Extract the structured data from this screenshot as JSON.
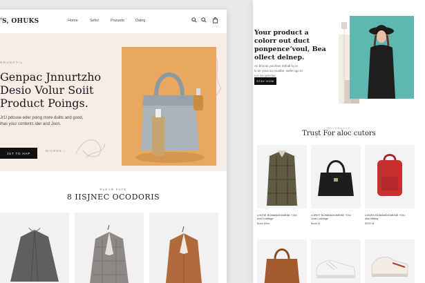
{
  "left": {
    "logo": "'S, OHUKS",
    "nav": [
      "Home",
      "Sefor",
      "Pozuots",
      "Dalng"
    ],
    "hero": {
      "eyebrow": "NRUEFTIL",
      "headline_lines": [
        "Genpac Jnnurtzho",
        "Desio Volur Soiit",
        "Product Poings."
      ],
      "subtext_lines": [
        "Jr1I pdcuse eder poing more dulits and good,",
        "ihas your contents ider and Joon."
      ],
      "primary_button": "JUT TO HAP",
      "secondary_link": "NICHOS ›"
    },
    "section": {
      "eyebrow": "PLEAR FATE",
      "title": "8 IISJNEC OCODORIS"
    }
  },
  "right": {
    "headline_lines": [
      "Your product a",
      "colorr out duct",
      "ponpenceʼvoul, Bea",
      "ollect delnep."
    ],
    "subtext_lines": [
      "An bhoots you feos trefudl lo ce",
      "lu ter yous sa rouatbe, welle ngo to",
      "cur ocu pricous."
    ],
    "button": "STAY HOW",
    "section": {
      "eyebrow": "SUYERAUGE",
      "title": "Trust For aloc cutors",
      "products": [
        {
          "name": "LHOSE BOMANDIGMENE YOU",
          "sub": "Ans Lnddoge",
          "price": "$ose Mesl"
        },
        {
          "name": "LOROT BOMANDIGMENE YOU",
          "sub": "Gost Loddage",
          "price": "$ode M"
        },
        {
          "name": "LOGRS BOMANDIGMENE YOU",
          "sub": "Abo Mtlleg",
          "price": "$200 M"
        }
      ]
    }
  },
  "colors": {
    "hero_bg": "#f7ede6",
    "accent_orange": "#e8a95f",
    "teal_bg": "#5fb8b0",
    "button_dark": "#111111"
  }
}
